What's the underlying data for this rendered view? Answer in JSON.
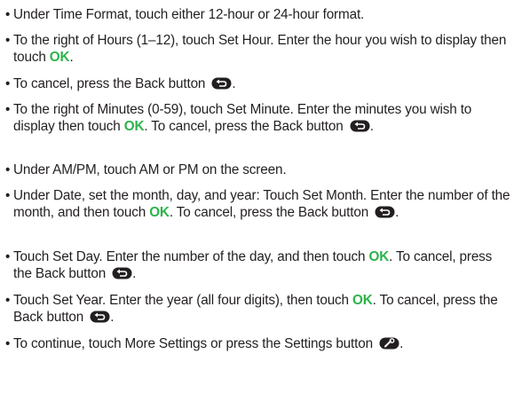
{
  "doc": {
    "bullet": "•",
    "ok": "OK",
    "item1": {
      "text": "Under Time Format, touch either 12-hour or 24-hour format."
    },
    "item2": {
      "a": "To the right of Hours (1–12), touch Set Hour. Enter the hour you wish to display then touch ",
      "b": "."
    },
    "item3": {
      "a": "To cancel, press the Back button ",
      "b": "."
    },
    "item4": {
      "a": "To the right of Minutes (0-59), touch Set Minute. Enter the minutes you wish to display then touch ",
      "b": ". To cancel, press the Back button ",
      "c": "."
    },
    "item5": {
      "text": "Under AM/PM, touch AM or PM on the screen."
    },
    "item6": {
      "a": "Under Date, set the month, day, and year: Touch Set Month. Enter the number of the month, and then touch ",
      "b": ". To cancel, press the Back button ",
      "c": "."
    },
    "item7": {
      "a": "Touch Set Day. Enter the number of the day, and then touch ",
      "b": ". To cancel, press the Back button ",
      "c": "."
    },
    "item8": {
      "a": "Touch Set Year. Enter the year (all four digits), then touch ",
      "b": ". To cancel, press the Back button ",
      "c": "."
    },
    "item9": {
      "a": "To continue, touch More Settings or press the Settings button ",
      "b": "."
    },
    "icons": {
      "back": "back-arrow-icon",
      "settings": "wrench-icon"
    },
    "colors": {
      "ok": "#2db34a",
      "text": "#231f20",
      "button": "#231f20"
    }
  }
}
